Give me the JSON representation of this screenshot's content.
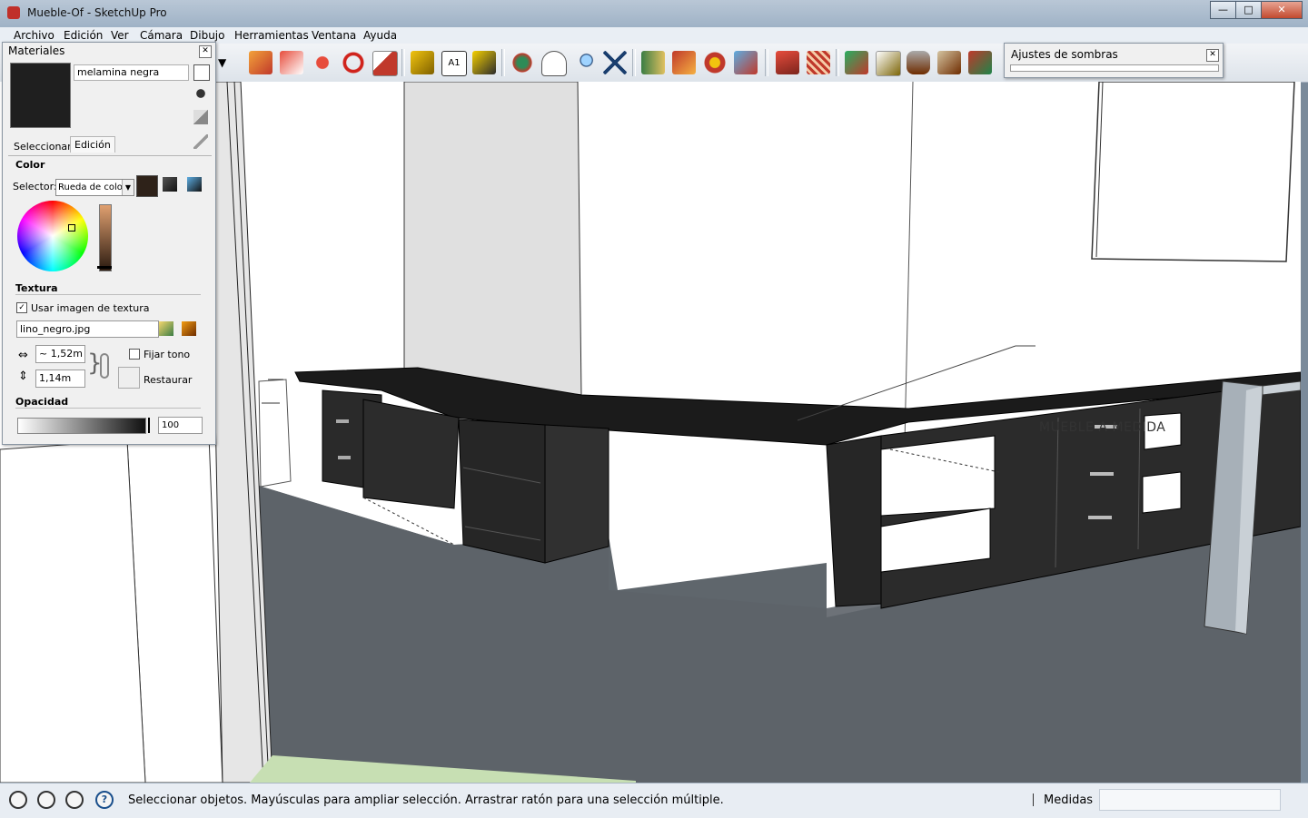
{
  "window": {
    "title": "Mueble-Of - SketchUp Pro",
    "minimize": "—",
    "maximize": "□",
    "close": "✕"
  },
  "menu": [
    "Archivo",
    "Edición",
    "Ver",
    "Cámara",
    "Dibujo",
    "Herramientas",
    "Ventana",
    "Ayuda"
  ],
  "toolbar_icons": [
    "push-pull-icon",
    "follow-me-icon",
    "move-icon",
    "rotate-icon",
    "scale-icon",
    "tape-measure-icon",
    "text-icon",
    "paint-bucket-icon",
    "orbit-icon",
    "pan-icon",
    "zoom-icon",
    "zoom-extents-icon",
    "map-icon",
    "section-plane-icon",
    "camera-icon",
    "export-icon",
    "sandbox-from-contours-icon",
    "sandbox-grid-icon",
    "smoove-icon",
    "stamp-icon",
    "drape-icon",
    "add-detail-icon",
    "flip-edge-icon"
  ],
  "materials": {
    "title": "Materiales",
    "material_name": "melamina negra",
    "tabs": [
      "Seleccionar",
      "Edición"
    ],
    "color_section": "Color",
    "selector_label": "Selector:",
    "selector_value": "Rueda de color",
    "texture_section": "Textura",
    "use_texture_label": "Usar imagen de textura",
    "use_texture_checked": "✓",
    "texture_file": "lino_negro.jpg",
    "width": "~ 1,52m",
    "height": "1,14m",
    "fix_hue_label": "Fijar tono",
    "restore_label": "Restaurar",
    "opacity_section": "Opacidad",
    "opacity_value": "100",
    "swatch_color": "#1f1f1f",
    "chip_color": "#2e2219"
  },
  "shadows": {
    "title": "Ajustes de sombras"
  },
  "viewport": {
    "annotation": "MUEBLE A MEDIDA"
  },
  "status": {
    "message": "Seleccionar objetos. Mayúsculas para ampliar selección. Arrastrar ratón para una selección múltiple.",
    "measure_label": "Medidas",
    "measure_value": "",
    "help_glyph": "?"
  }
}
